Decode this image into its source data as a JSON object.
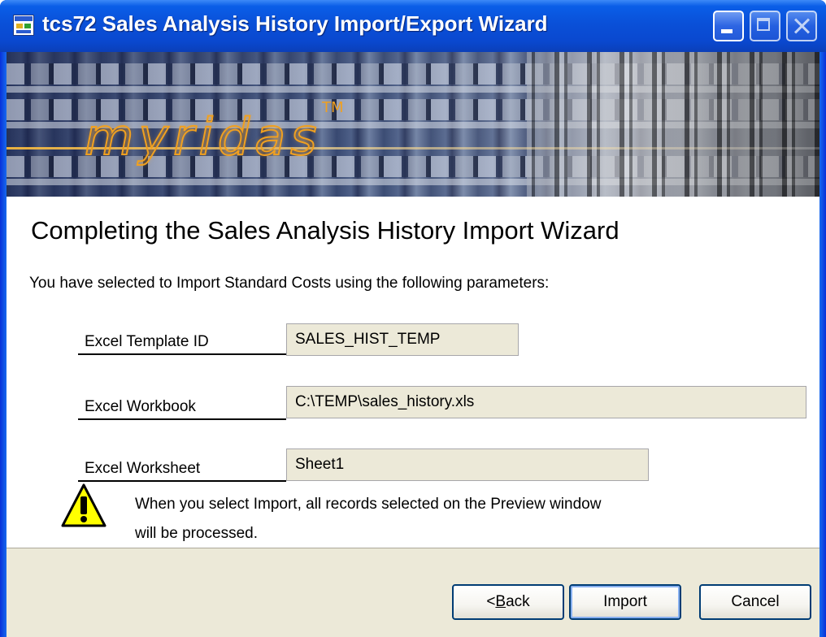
{
  "window": {
    "title": "tcs72 Sales Analysis History Import/Export Wizard"
  },
  "banner": {
    "logo_text": "myridas",
    "trademark": "TM"
  },
  "main": {
    "heading": "Completing the Sales Analysis History Import Wizard",
    "intro": "You have selected to Import Standard Costs using the following parameters:",
    "fields": [
      {
        "label": "Excel Template ID",
        "value": "SALES_HIST_TEMP"
      },
      {
        "label": "Excel Workbook",
        "value": "C:\\TEMP\\sales_history.xls"
      },
      {
        "label": "Excel Worksheet",
        "value": "Sheet1"
      }
    ],
    "warning": {
      "icon": "warning-icon",
      "line1": "When you select Import, all records selected on the Preview window",
      "line2": "will be processed."
    }
  },
  "footer": {
    "back_prefix": "< ",
    "back_mnemonic": "B",
    "back_rest": "ack",
    "import_label": "Import",
    "cancel_label": "Cancel"
  },
  "colors": {
    "titlebar": "#0a50d8",
    "dialog_bg": "#ece9d8",
    "logo_orange": "#f0a020"
  }
}
